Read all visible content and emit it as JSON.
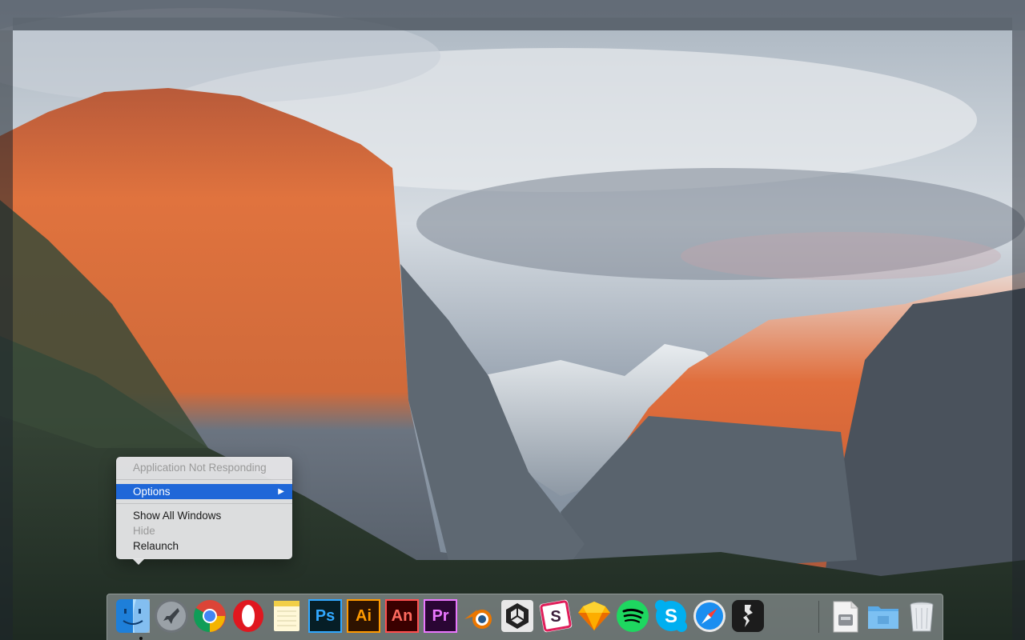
{
  "menu": {
    "header": "Application Not Responding",
    "options": "Options",
    "submenu_glyph": "▶",
    "show_all_windows": "Show All Windows",
    "hide": "Hide",
    "relaunch": "Relaunch"
  },
  "dock": {
    "apps": [
      {
        "name": "finder-icon"
      },
      {
        "name": "launchpad-icon"
      },
      {
        "name": "chrome-icon"
      },
      {
        "name": "opera-icon"
      },
      {
        "name": "notes-icon"
      },
      {
        "name": "photoshop-icon",
        "label": "Ps"
      },
      {
        "name": "illustrator-icon",
        "label": "Ai"
      },
      {
        "name": "animate-icon",
        "label": "An"
      },
      {
        "name": "premiere-icon",
        "label": "Pr"
      },
      {
        "name": "blender-icon"
      },
      {
        "name": "unity-icon"
      },
      {
        "name": "slack-icon"
      },
      {
        "name": "sketch-icon"
      },
      {
        "name": "spotify-icon"
      },
      {
        "name": "skype-icon"
      },
      {
        "name": "safari-icon"
      },
      {
        "name": "tool-icon"
      },
      {
        "name": "installer-icon"
      },
      {
        "name": "folder-icon"
      },
      {
        "name": "trash-icon"
      }
    ]
  },
  "colors": {
    "menu_highlight": "#1f67d8",
    "photoshop": "#31a8ff",
    "illustrator": "#ff9a00",
    "animate": "#ff4f4f",
    "premiere": "#ea77ff"
  }
}
